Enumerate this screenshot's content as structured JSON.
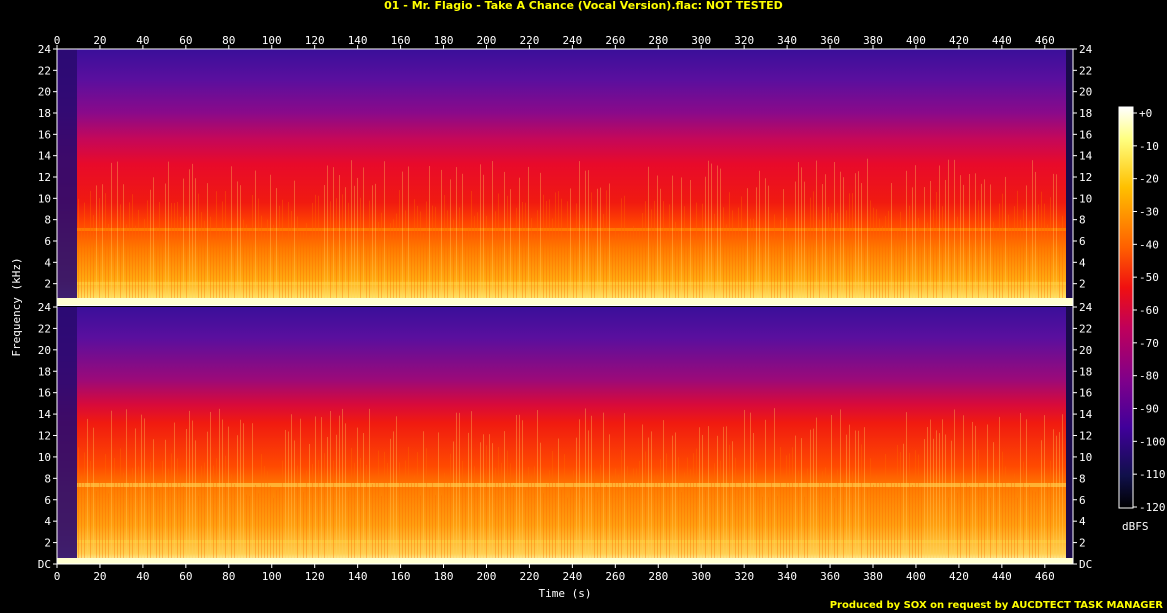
{
  "title": "01 - Mr. Flagio - Take A Chance (Vocal Version).flac: NOT TESTED",
  "footer": "Produced by SOX on request by AUCDTECT TASK MANAGER",
  "chart_data": {
    "type": "heatmap",
    "title": "01 - Mr. Flagio - Take A Chance (Vocal Version).flac: NOT TESTED",
    "xlabel": "Time (s)",
    "ylabel": "Frequency (kHz)",
    "xlim": [
      0,
      475
    ],
    "x_ticks": [
      "0",
      "20",
      "40",
      "60",
      "80",
      "100",
      "120",
      "140",
      "160",
      "180",
      "200",
      "220",
      "240",
      "260",
      "280",
      "300",
      "320",
      "340",
      "360",
      "380",
      "400",
      "420",
      "440",
      "460"
    ],
    "ylim": [
      0,
      24
    ],
    "y_ticks_upper": [
      "2",
      "4",
      "6",
      "8",
      "10",
      "12",
      "14",
      "16",
      "18",
      "20",
      "22",
      "24"
    ],
    "y_ticks_lower": [
      "DC",
      "2",
      "4",
      "6",
      "8",
      "10",
      "12",
      "14",
      "16",
      "18",
      "20",
      "22",
      "24"
    ],
    "channels": 2,
    "colorbar": {
      "label": "dBFS",
      "range": [
        -120,
        0
      ],
      "ticks": [
        "+0",
        "-10",
        "-20",
        "-30",
        "-40",
        "-50",
        "-60",
        "-70",
        "-80",
        "-90",
        "-100",
        "-110",
        "-120"
      ]
    },
    "colors": {
      "title": "#ffff00",
      "high": "#ffffe0",
      "mid": "#ff2a00",
      "low": "#3a0a9a",
      "silence": "#0a0a3a"
    }
  }
}
